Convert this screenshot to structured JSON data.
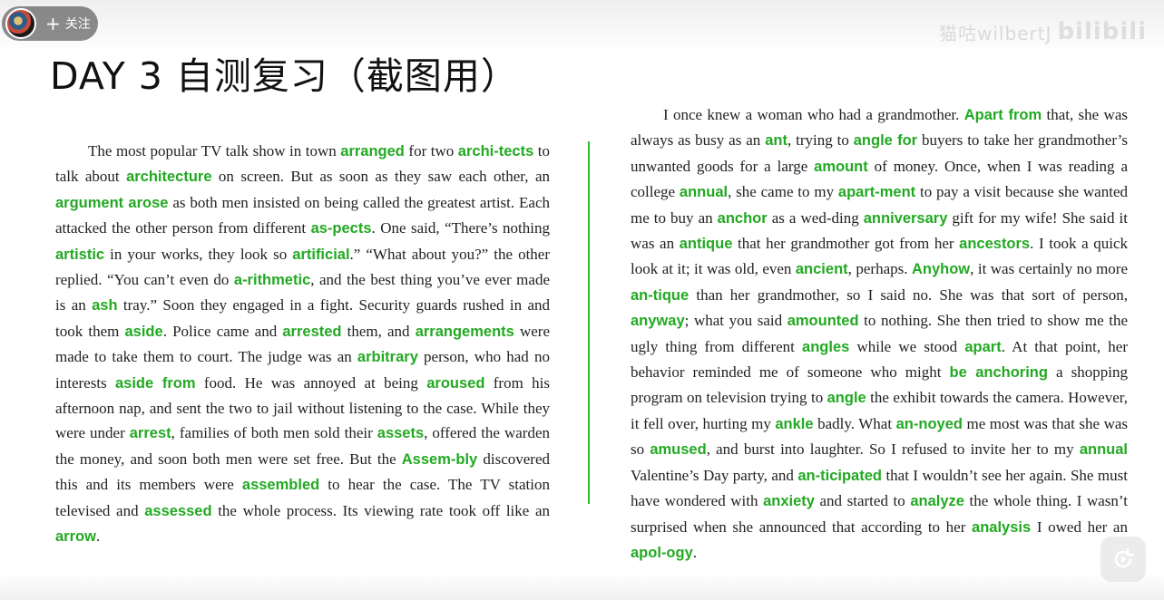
{
  "header": {
    "follow_label": "关注",
    "watermark_text": "猫咕wilbertJ",
    "watermark_logo": "bilibili"
  },
  "title": "DAY 3 自测复习（截图用）",
  "colors": {
    "highlight": "#22a922",
    "divider": "#2dbb2d",
    "text": "#222222"
  },
  "left_passage": [
    {
      "t": "The most popular TV talk show in town "
    },
    {
      "t": "arranged",
      "h": true
    },
    {
      "t": " for two "
    },
    {
      "t": "archi-tects",
      "h": true
    },
    {
      "t": " to talk about "
    },
    {
      "t": "architecture",
      "h": true
    },
    {
      "t": " on screen. But as soon as they saw each other, an "
    },
    {
      "t": "argument arose",
      "h": true
    },
    {
      "t": " as both men insisted on being called the greatest artist. Each attacked the other person from different "
    },
    {
      "t": "as-pects",
      "h": true
    },
    {
      "t": ". One said, “There’s nothing "
    },
    {
      "t": "artistic",
      "h": true
    },
    {
      "t": " in your works, they look so "
    },
    {
      "t": "artificial",
      "h": true
    },
    {
      "t": ".” “What about you?” the other replied. “You can’t even do "
    },
    {
      "t": "a-rithmetic",
      "h": true
    },
    {
      "t": ", and the best thing you’ve ever made is an "
    },
    {
      "t": "ash",
      "h": true
    },
    {
      "t": " tray.” Soon they engaged in a fight. Security guards rushed in and took them "
    },
    {
      "t": "aside",
      "h": true
    },
    {
      "t": ". Police came and "
    },
    {
      "t": "arrested",
      "h": true
    },
    {
      "t": " them, and "
    },
    {
      "t": "arrangements",
      "h": true
    },
    {
      "t": " were made to take them to court. The judge was an "
    },
    {
      "t": "arbitrary",
      "h": true
    },
    {
      "t": " person, who had no interests "
    },
    {
      "t": "aside from",
      "h": true
    },
    {
      "t": " food. He was annoyed at being "
    },
    {
      "t": "aroused",
      "h": true
    },
    {
      "t": " from his afternoon nap, and sent the two to jail without listening to the case. While they were under "
    },
    {
      "t": "arrest",
      "h": true
    },
    {
      "t": ", families of both men sold their "
    },
    {
      "t": "assets",
      "h": true
    },
    {
      "t": ", offered the warden the money, and soon both men were set free. But the "
    },
    {
      "t": "Assem-bly",
      "h": true
    },
    {
      "t": " discovered this and its members were "
    },
    {
      "t": "assembled",
      "h": true
    },
    {
      "t": " to hear the case. The TV station televised and "
    },
    {
      "t": "assessed",
      "h": true
    },
    {
      "t": " the whole process. Its viewing rate took off like an "
    },
    {
      "t": "arrow",
      "h": true
    },
    {
      "t": "."
    }
  ],
  "right_passage": [
    {
      "t": "I once knew a woman who had a grandmother. "
    },
    {
      "t": "Apart from",
      "h": true
    },
    {
      "t": " that, she was always as busy as an "
    },
    {
      "t": "ant",
      "h": true
    },
    {
      "t": ", trying to "
    },
    {
      "t": "angle for",
      "h": true
    },
    {
      "t": " buyers to take her grandmother’s unwanted goods for a large "
    },
    {
      "t": "amount",
      "h": true
    },
    {
      "t": " of money. Once, when I was reading a college "
    },
    {
      "t": "annual",
      "h": true
    },
    {
      "t": ", she came to my "
    },
    {
      "t": "apart-ment",
      "h": true
    },
    {
      "t": " to pay a visit because she wanted me to buy an "
    },
    {
      "t": "anchor",
      "h": true
    },
    {
      "t": " as a wed-ding "
    },
    {
      "t": "anniversary",
      "h": true
    },
    {
      "t": " gift for my wife! She said it was an "
    },
    {
      "t": "antique",
      "h": true
    },
    {
      "t": " that her grandmother got from her "
    },
    {
      "t": "ancestors",
      "h": true
    },
    {
      "t": ". I took a quick look at it; it was old, even "
    },
    {
      "t": "ancient",
      "h": true
    },
    {
      "t": ", perhaps. "
    },
    {
      "t": "Anyhow",
      "h": true
    },
    {
      "t": ", it was certainly no more "
    },
    {
      "t": "an-tique",
      "h": true
    },
    {
      "t": " than her grandmother, so I said no. She was that sort of person, "
    },
    {
      "t": "anyway",
      "h": true
    },
    {
      "t": "; what you said "
    },
    {
      "t": "amounted",
      "h": true
    },
    {
      "t": " to nothing. She then tried to show me the ugly thing from different "
    },
    {
      "t": "angles",
      "h": true
    },
    {
      "t": " while we stood "
    },
    {
      "t": "apart",
      "h": true
    },
    {
      "t": ". At that point, her behavior reminded me of someone who might "
    },
    {
      "t": "be anchoring",
      "h": true
    },
    {
      "t": " a shopping program on television trying to "
    },
    {
      "t": "angle",
      "h": true
    },
    {
      "t": " the exhibit towards the camera. However, it fell over, hurting my "
    },
    {
      "t": "ankle",
      "h": true
    },
    {
      "t": " badly. What "
    },
    {
      "t": "an-noyed",
      "h": true
    },
    {
      "t": " me most was that she was so "
    },
    {
      "t": "amused",
      "h": true
    },
    {
      "t": ", and burst into laughter. So I refused to invite her to my "
    },
    {
      "t": "annual",
      "h": true
    },
    {
      "t": " Valentine’s Day party, and "
    },
    {
      "t": "an-ticipated",
      "h": true
    },
    {
      "t": " that I wouldn’t see her again. She must have wondered with "
    },
    {
      "t": "anxiety",
      "h": true
    },
    {
      "t": " and started to "
    },
    {
      "t": "analyze",
      "h": true
    },
    {
      "t": " the whole thing. I wasn’t surprised when she announced that according to her "
    },
    {
      "t": "analysis",
      "h": true
    },
    {
      "t": " I owed her an "
    },
    {
      "t": "apol-ogy",
      "h": true
    },
    {
      "t": "."
    }
  ]
}
